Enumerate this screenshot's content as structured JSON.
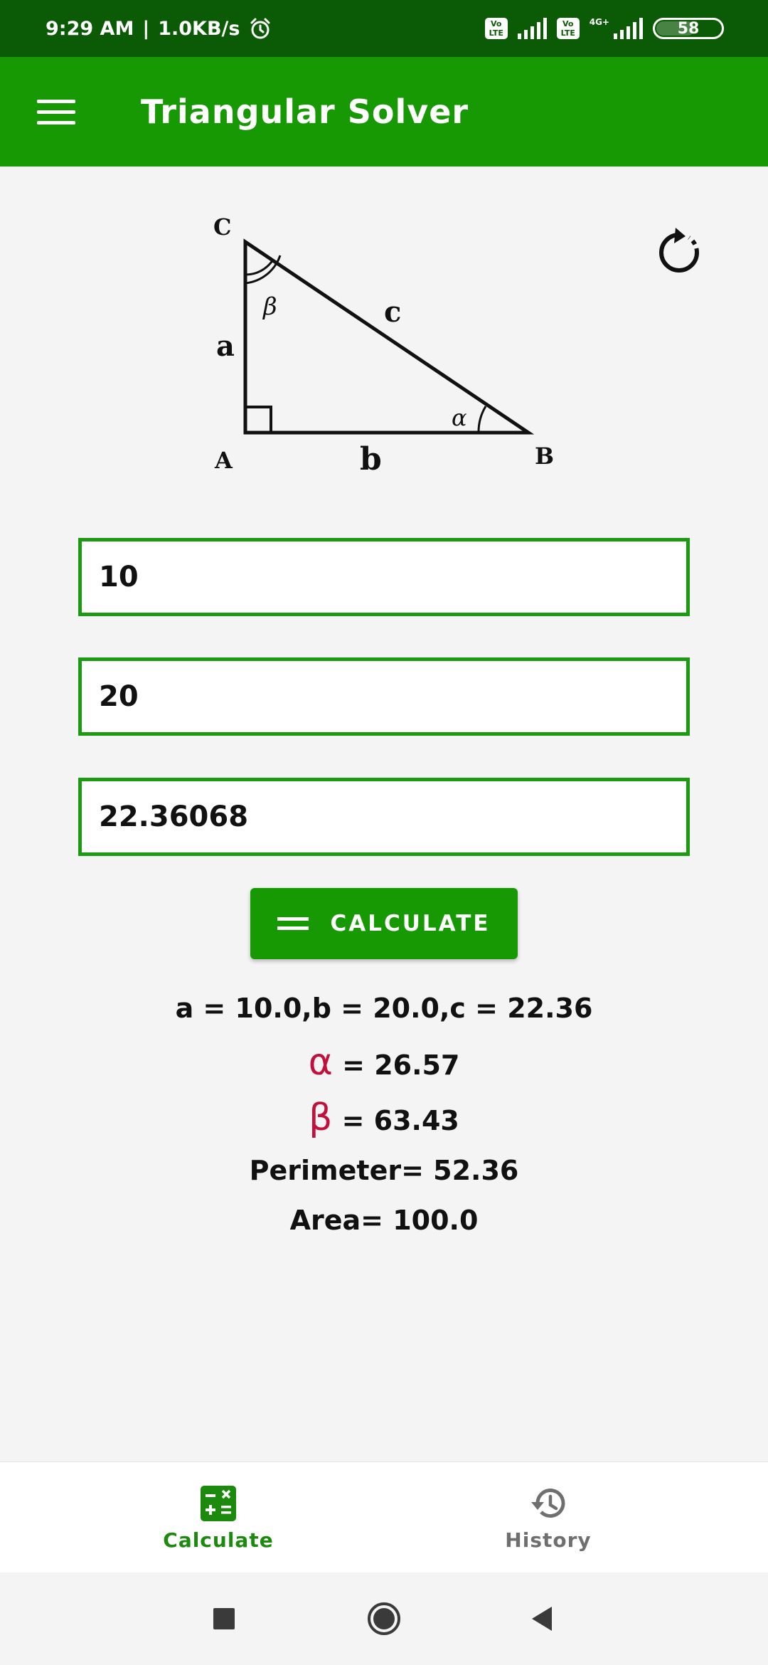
{
  "status_bar": {
    "time": "9:29 AM",
    "separator": "|",
    "net_speed": "1.0KB/s",
    "volte_1": "Vo LTE",
    "volte_2": "Vo LTE",
    "network_type": "4G+",
    "battery_level": "58",
    "icons": [
      "alarm-icon",
      "volte-icon",
      "signal-icon",
      "battery-icon"
    ]
  },
  "app_bar": {
    "title": "Triangular Solver",
    "menu_icon": "hamburger-menu-icon"
  },
  "diagram": {
    "vertex_a": "A",
    "vertex_b": "B",
    "vertex_c": "C",
    "side_a": "a",
    "side_b": "b",
    "side_c": "c",
    "angle_alpha": "α",
    "angle_beta": "β"
  },
  "refresh_icon": "refresh-icon",
  "inputs": {
    "side_a_value": "10",
    "side_b_value": "20",
    "side_c_value": "22.36068"
  },
  "calculate_button": {
    "label": "CALCULATE",
    "icon": "equals-icon"
  },
  "results": {
    "sides": "a = 10.0,b = 20.0,c = 22.36",
    "alpha_symbol": "α",
    "alpha_value": " = 26.57",
    "beta_symbol": "β",
    "beta_value": " = 63.43",
    "perimeter": "Perimeter= 52.36",
    "area": "Area= 100.0"
  },
  "bottom_nav": {
    "calculate_label": "Calculate",
    "history_label": "History",
    "active": "Calculate"
  },
  "colors": {
    "status_bar": "#0b5a05",
    "app_bar": "#179903",
    "input_border": "#1c9a12",
    "greek_accent": "#c2103c",
    "nav_active": "#1c8a0d",
    "nav_inactive": "#6f6f6f"
  }
}
